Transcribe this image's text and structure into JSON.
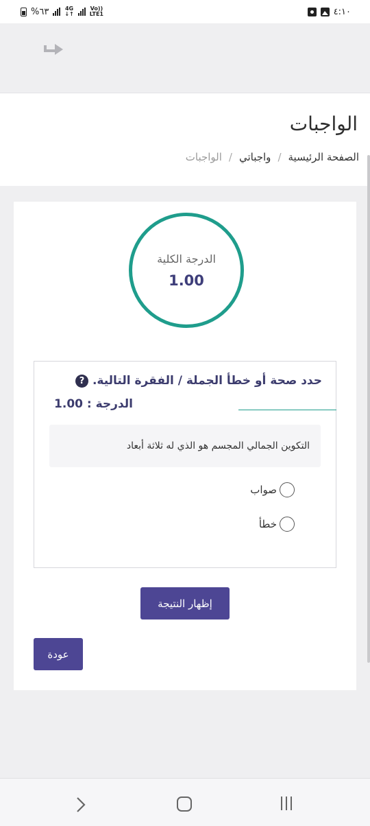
{
  "status_bar": {
    "time": "٤:١٠",
    "battery_percent": "%٦٣",
    "net_4g": "4G",
    "net_volte_top": "Vo))",
    "net_volte_bottom": "LTE1"
  },
  "header": {
    "title": "الواجبات",
    "breadcrumb": [
      {
        "label": "الصفحة الرئيسية"
      },
      {
        "label": "واجباتي"
      },
      {
        "label": "الواجبات"
      }
    ],
    "separator": "/"
  },
  "score": {
    "label": "الدرجة الكلية",
    "value": "1.00"
  },
  "question": {
    "title": "حدد صحة أو خطأ الجملة / الفقرة التالية.",
    "grade": "الدرجة : 1.00",
    "text": "التكوين الجمالي المجسم هو الذي له ثلاثة أبعاد",
    "options": [
      {
        "label": "صواب",
        "selected": false
      },
      {
        "label": "خطأ",
        "selected": false
      }
    ],
    "help_glyph": "?"
  },
  "buttons": {
    "show_result": "إظهار النتيجة",
    "back": "عودة"
  },
  "colors": {
    "accent": "#4d4694",
    "circle": "#1f9d8c",
    "title_text": "#3c3c6e"
  }
}
